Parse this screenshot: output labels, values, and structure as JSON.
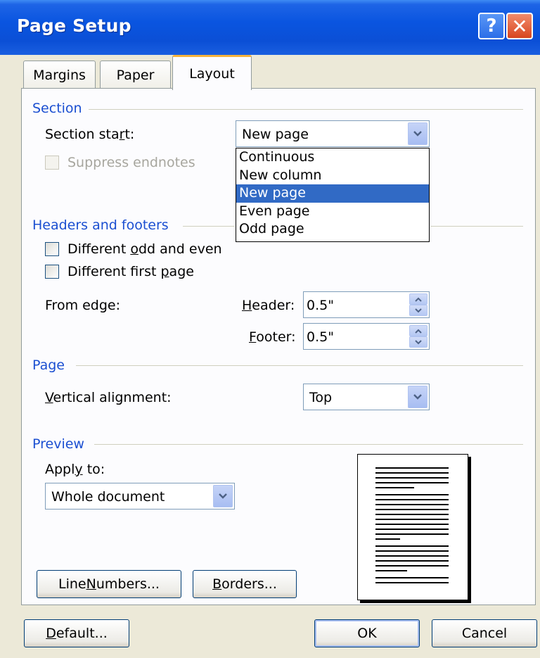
{
  "dialog": {
    "title": "Page Setup",
    "help_icon": "help-icon",
    "close_icon": "close-icon"
  },
  "tabs": [
    {
      "label": "Margins",
      "active": false
    },
    {
      "label": "Paper",
      "active": false
    },
    {
      "label": "Layout",
      "active": true
    }
  ],
  "section": {
    "group_label": "Section",
    "start_label_pre": "Section sta",
    "start_label_acc": "r",
    "start_label_post": "t:",
    "start_value": "New page",
    "suppress_endnotes_label": "Suppress endnotes",
    "suppress_endnotes_checked": false,
    "suppress_endnotes_enabled": false,
    "start_options": [
      "Continuous",
      "New column",
      "New page",
      "Even page",
      "Odd page"
    ],
    "selected_option": "New page"
  },
  "headers_footers": {
    "group_label": "Headers and footers",
    "odd_even_pre": "Different ",
    "odd_even_acc": "o",
    "odd_even_post": "dd and even",
    "odd_even_checked": false,
    "first_page_pre": "Different first ",
    "first_page_acc": "p",
    "first_page_post": "age",
    "first_page_checked": false,
    "from_edge_label": "From edge:",
    "header_label_acc": "H",
    "header_label_post": "eader:",
    "header_value": "0.5\"",
    "footer_label_acc": "F",
    "footer_label_post": "ooter:",
    "footer_value": "0.5\""
  },
  "page": {
    "group_label": "Page",
    "valign_label_acc": "V",
    "valign_label_post": "ertical alignment:",
    "valign_value": "Top"
  },
  "preview": {
    "group_label": "Preview",
    "apply_to_pre": "Appl",
    "apply_to_acc": "y",
    "apply_to_post": " to:",
    "apply_to_value": "Whole document",
    "line_numbers_pre": "Line ",
    "line_numbers_acc": "N",
    "line_numbers_post": "umbers...",
    "borders_acc": "B",
    "borders_post": "orders..."
  },
  "footer_buttons": {
    "default_acc": "D",
    "default_post": "efault...",
    "ok": "OK",
    "cancel": "Cancel"
  },
  "colors": {
    "titlebar": "#0a55e0",
    "dialog_bg": "#ece9d8",
    "group_label": "#1b4fd1",
    "selection": "#316ac5",
    "active_tab_accent": "#f6b33c"
  }
}
